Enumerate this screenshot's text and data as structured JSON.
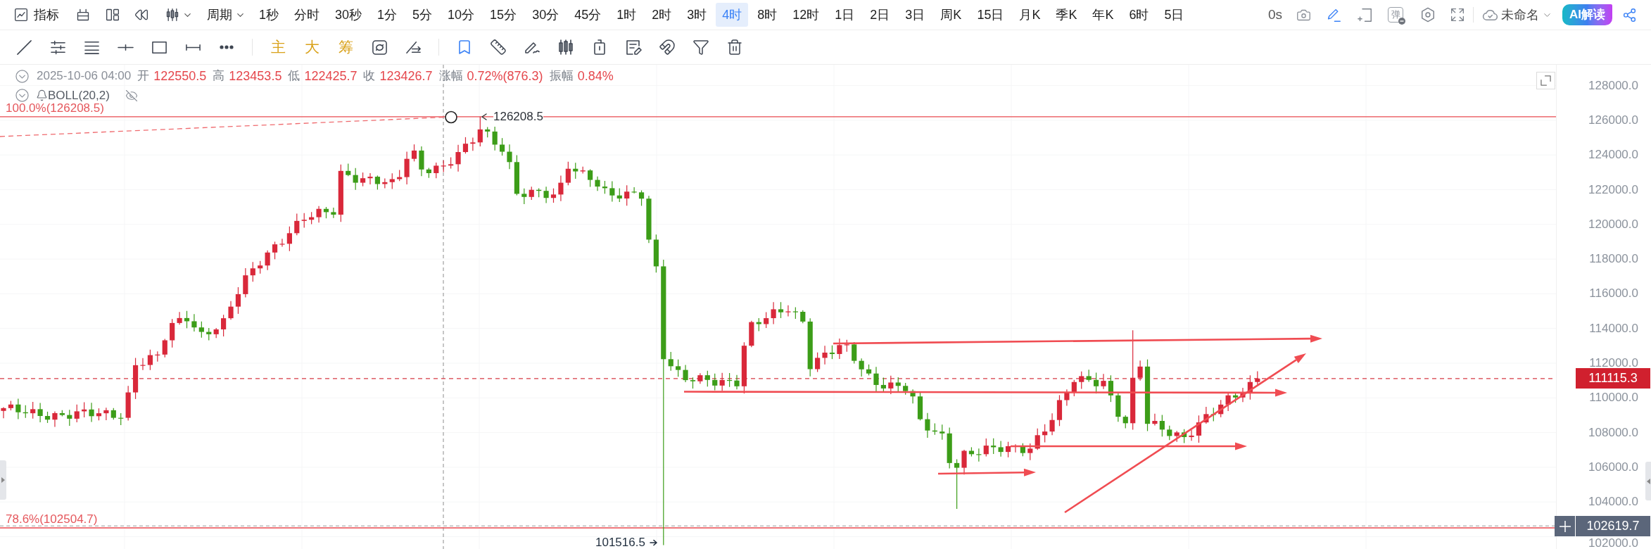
{
  "toolbar": {
    "indicators_button": "指标",
    "period_dropdown": "周期",
    "intervals": [
      {
        "label": "1秒",
        "selected": false
      },
      {
        "label": "分时",
        "selected": false
      },
      {
        "label": "30秒",
        "selected": false
      },
      {
        "label": "1分",
        "selected": false
      },
      {
        "label": "5分",
        "selected": false
      },
      {
        "label": "10分",
        "selected": false
      },
      {
        "label": "15分",
        "selected": false
      },
      {
        "label": "30分",
        "selected": false
      },
      {
        "label": "45分",
        "selected": false
      },
      {
        "label": "1时",
        "selected": false
      },
      {
        "label": "2时",
        "selected": false
      },
      {
        "label": "3时",
        "selected": false
      },
      {
        "label": "4时",
        "selected": true
      },
      {
        "label": "8时",
        "selected": false
      },
      {
        "label": "12时",
        "selected": false
      },
      {
        "label": "1日",
        "selected": false
      },
      {
        "label": "2日",
        "selected": false
      },
      {
        "label": "3日",
        "selected": false
      },
      {
        "label": "周K",
        "selected": false
      },
      {
        "label": "15日",
        "selected": false
      },
      {
        "label": "月K",
        "selected": false
      },
      {
        "label": "季K",
        "selected": false
      },
      {
        "label": "年K",
        "selected": false
      },
      {
        "label": "6时",
        "selected": false
      },
      {
        "label": "5日",
        "selected": false
      }
    ],
    "timer": "0s",
    "barrage_toggle": "弹",
    "layout_name": "未命名",
    "ai_button": "AI解读"
  },
  "drawing_toolbar": {
    "overlay_buttons": [
      "主",
      "大",
      "筹"
    ]
  },
  "chart": {
    "ohlc": {
      "datetime": "2025-10-06 04:00",
      "fields": [
        {
          "label": "开",
          "value": "122550.5"
        },
        {
          "label": "高",
          "value": "123453.5"
        },
        {
          "label": "低",
          "value": "122425.7"
        },
        {
          "label": "收",
          "value": "123426.7"
        },
        {
          "label": "涨幅",
          "value": "0.72%(876.3)"
        },
        {
          "label": "振幅",
          "value": "0.84%"
        }
      ]
    },
    "indicator": "BOLL(20,2)",
    "fib_levels": [
      {
        "label": "100.0%(126208.5)"
      },
      {
        "label": "78.6%(102504.7)"
      }
    ],
    "high_label": "126208.5",
    "low_label": "101516.5",
    "y_axis": {
      "ticks": [
        "128000.0",
        "126000.0",
        "124000.0",
        "122000.0",
        "120000.0",
        "118000.0",
        "116000.0",
        "114000.0",
        "112000.0",
        "110000.0",
        "108000.0",
        "106000.0",
        "104000.0",
        "102000.0"
      ],
      "last_price": "111115.3",
      "cursor_price": "102619.7"
    }
  }
}
